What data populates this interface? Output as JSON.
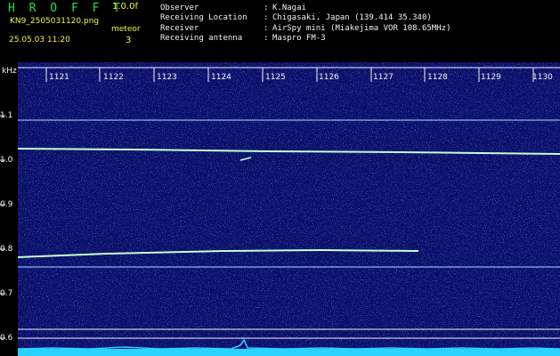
{
  "header": {
    "app_name": "H R O F F T",
    "version": "1.0.0f",
    "filename": "KN9_2505031120.png",
    "meteor_label": "meteor",
    "datetime": "25.05.03 11:20",
    "meteor_count": "3"
  },
  "station_info": [
    {
      "label": "Observer",
      "value": "K.Nagai"
    },
    {
      "label": "Receiving Location",
      "value": "Chigasaki, Japan (139.414 35.340)"
    },
    {
      "label": "Receiver",
      "value": "AirSpy mini (Miakejima VOR 108.65MHz)"
    },
    {
      "label": "Receiving antenna",
      "value": "Maspro FM-3"
    }
  ],
  "separator": ":",
  "spectrogram": {
    "y_unit": "kHz",
    "y_ticks": [
      "1.1",
      "1.0",
      "0.9",
      "0.8",
      "0.7",
      "0.6"
    ],
    "x_ticks": [
      "1121",
      "1122",
      "1123",
      "1124",
      "1125",
      "1126",
      "1127",
      "1128",
      "1129",
      "1130"
    ],
    "background_color": "#0a0f6a",
    "trace_color": "#3ad6ff",
    "line_color": "#c8ffd0"
  }
}
